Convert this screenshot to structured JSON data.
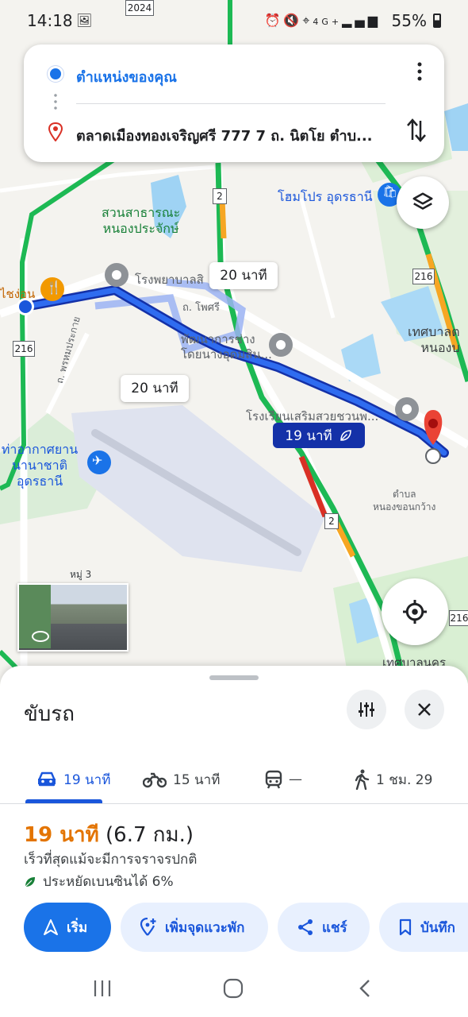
{
  "status_bar": {
    "time": "14:18",
    "battery": "55%",
    "network": "4G+"
  },
  "search_card": {
    "origin": "ตำแหน่งของคุณ",
    "destination": "ตลาดเมืองทองเจริญศรี 777 7 ถ. นิตโย ตำบ..."
  },
  "map": {
    "places": {
      "park": "สวนสาธารณะ\nหนองประจักษ์",
      "homepro": "โฮมโปร อุดรธานี",
      "hospital": "โรงพยาบาลสิ",
      "phosri": "ถ. โพศรี",
      "company": "พัฒนาการช่าง\nโดยนางอุดมสิน...",
      "school": "โรงเรียนเสริมสวยชวนพ...",
      "airport": "ท่าอากาศยาน\nนานาชาติ\nอุดรธานี",
      "municipality_right": "เทศบาลต\nหนองบ",
      "subdistrict": "ตำบล\nหนองขอนกว้าง",
      "village": "หมู่ 3",
      "city_municipality": "เทศบาลนคร",
      "restaurant": "ไชง่อน",
      "road_west": "ถ. พรหมประกาย",
      "route_2024": "2024",
      "route_216_left": "216",
      "route_216_right": "216",
      "route_216_bottom": "216",
      "route_2_top": "2",
      "route_2_mid": "2"
    },
    "route_labels": {
      "alt_top": "20 นาที",
      "alt_left": "20 นาที",
      "main": "19 นาที"
    }
  },
  "sheet": {
    "title": "ขับรถ",
    "tabs": [
      {
        "mode": "car-icon",
        "label": "19 นาที",
        "active": true
      },
      {
        "mode": "motorbike-icon",
        "label": "15 นาที",
        "active": false
      },
      {
        "mode": "transit-icon",
        "label": "—",
        "active": false
      },
      {
        "mode": "walk-icon",
        "label": "1 ชม. 29",
        "active": false
      }
    ],
    "duration": "19 นาที",
    "distance": "(6.7 กม.)",
    "description": "เร็วที่สุดแม้จะมีการจราจรปกติ",
    "eco": "ประหยัดเบนซินได้ 6%",
    "buttons": {
      "start": "เริ่ม",
      "add_stop": "เพิ่มจุดแวะพัก",
      "share": "แชร์",
      "save": "บันทึก"
    }
  },
  "colors": {
    "accent": "#1a73e8",
    "route": "#1a56db",
    "traffic_green": "#1db954",
    "traffic_orange": "#f6a623",
    "duration": "#e37400"
  }
}
